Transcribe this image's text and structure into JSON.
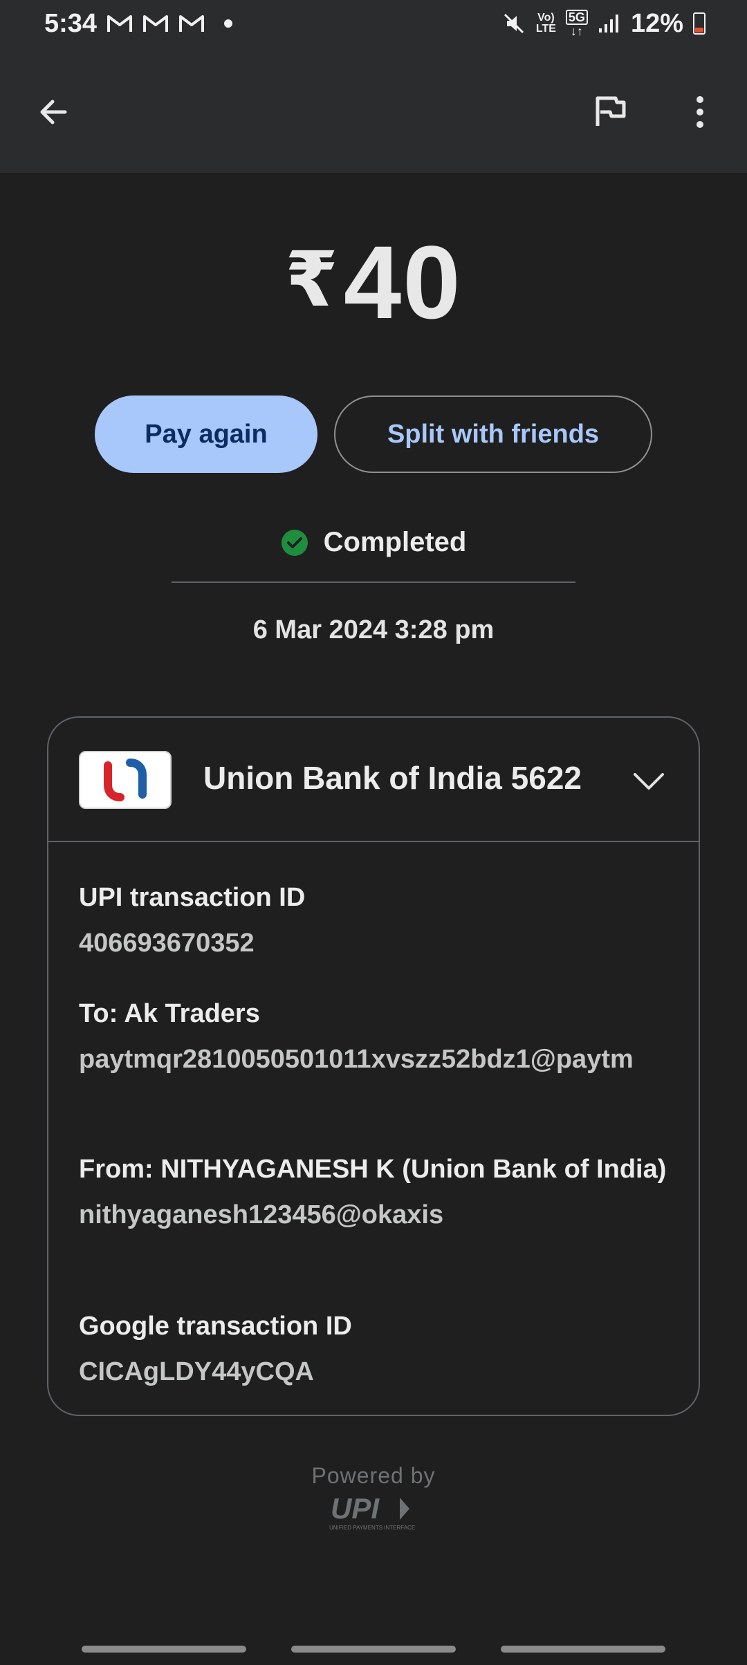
{
  "status_bar": {
    "time": "5:34",
    "network_top": "Vo)",
    "network_bottom": "LTE",
    "fiveg_top": "5G",
    "fiveg_bottom": "↓↑",
    "battery": "12%"
  },
  "amount": {
    "currency": "₹",
    "value": "40"
  },
  "actions": {
    "pay_again": "Pay again",
    "split": "Split with friends"
  },
  "status": {
    "label": "Completed",
    "color": "#1e8e3e"
  },
  "datetime": "6 Mar 2024 3:28 pm",
  "account": {
    "bank": "Union Bank of India 5622"
  },
  "details": {
    "upi_label": "UPI transaction ID",
    "upi_id": "406693670352",
    "to_label": "To: Ak Traders",
    "to_id": "paytmqr2810050501011xvszz52bdz1@paytm",
    "from_label": "From: NITHYAGANESH K (Union Bank of India)",
    "from_id": "nithyaganesh123456@okaxis",
    "google_label": "Google transaction ID",
    "google_id": "CICAgLDY44yCQA"
  },
  "footer": {
    "powered_by": "Powered by",
    "upi": "UPI",
    "upi_sub": "UNIFIED PAYMENTS INTERFACE"
  },
  "colors": {
    "accent": "#a8c7fa",
    "background": "#1f1f1f",
    "appbar": "#2b2c2e"
  }
}
